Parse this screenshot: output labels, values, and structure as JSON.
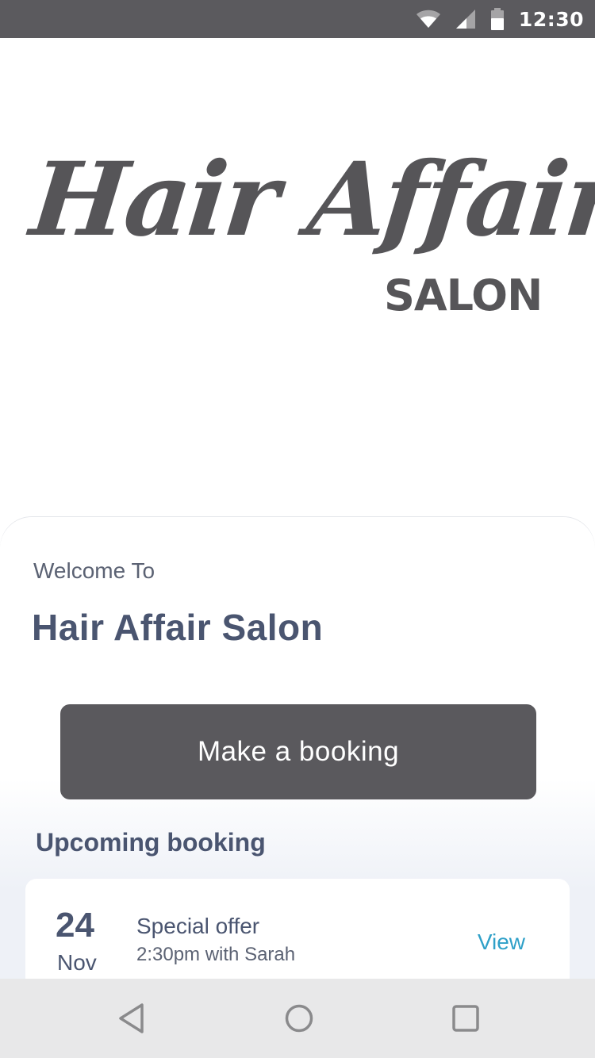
{
  "status_bar": {
    "time": "12:30",
    "icons": [
      "wifi-icon",
      "signal-icon",
      "battery-icon"
    ]
  },
  "logo": {
    "script_text": "Hair Affair",
    "sub_text": "SALON"
  },
  "welcome": {
    "greeting": "Welcome To",
    "salon_name": "Hair Affair Salon"
  },
  "booking_button": {
    "label": "Make a booking"
  },
  "upcoming": {
    "section_title": "Upcoming booking",
    "booking": {
      "day": "24",
      "month": "Nov",
      "title": "Special offer",
      "detail": "2:30pm with Sarah",
      "action_label": "View"
    }
  },
  "nav_bar": {
    "buttons": [
      "back-icon",
      "home-icon",
      "recents-icon"
    ]
  },
  "colors": {
    "status_bar": "#5b5a5e",
    "button": "#5a595d",
    "heading_text": "#4a5570",
    "link": "#2fa0c8",
    "nav_bar": "#e8e8e9"
  }
}
